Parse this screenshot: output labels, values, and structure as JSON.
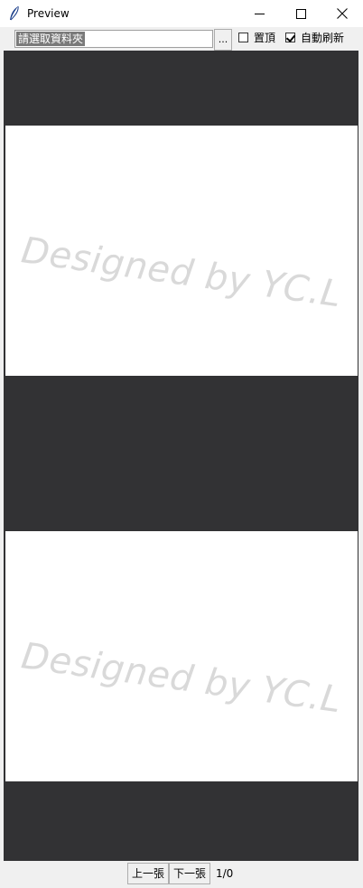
{
  "window": {
    "title": "Preview",
    "controls": {
      "minimize_icon": "minimize-icon",
      "maximize_icon": "maximize-icon",
      "close_icon": "close-icon"
    }
  },
  "toolbar": {
    "folder_placeholder": "請選取資料夾",
    "browse_label": "...",
    "pin_top": {
      "label": "置頂",
      "checked": false
    },
    "auto_refresh": {
      "label": "自動刷新",
      "checked": true
    }
  },
  "preview": {
    "watermark_text": "Designed by YC.L",
    "background_color": "#323234",
    "panel_color": "#ffffff"
  },
  "navigation": {
    "prev_label": "上一張",
    "next_label": "下一張",
    "page_counter": "1/0"
  }
}
